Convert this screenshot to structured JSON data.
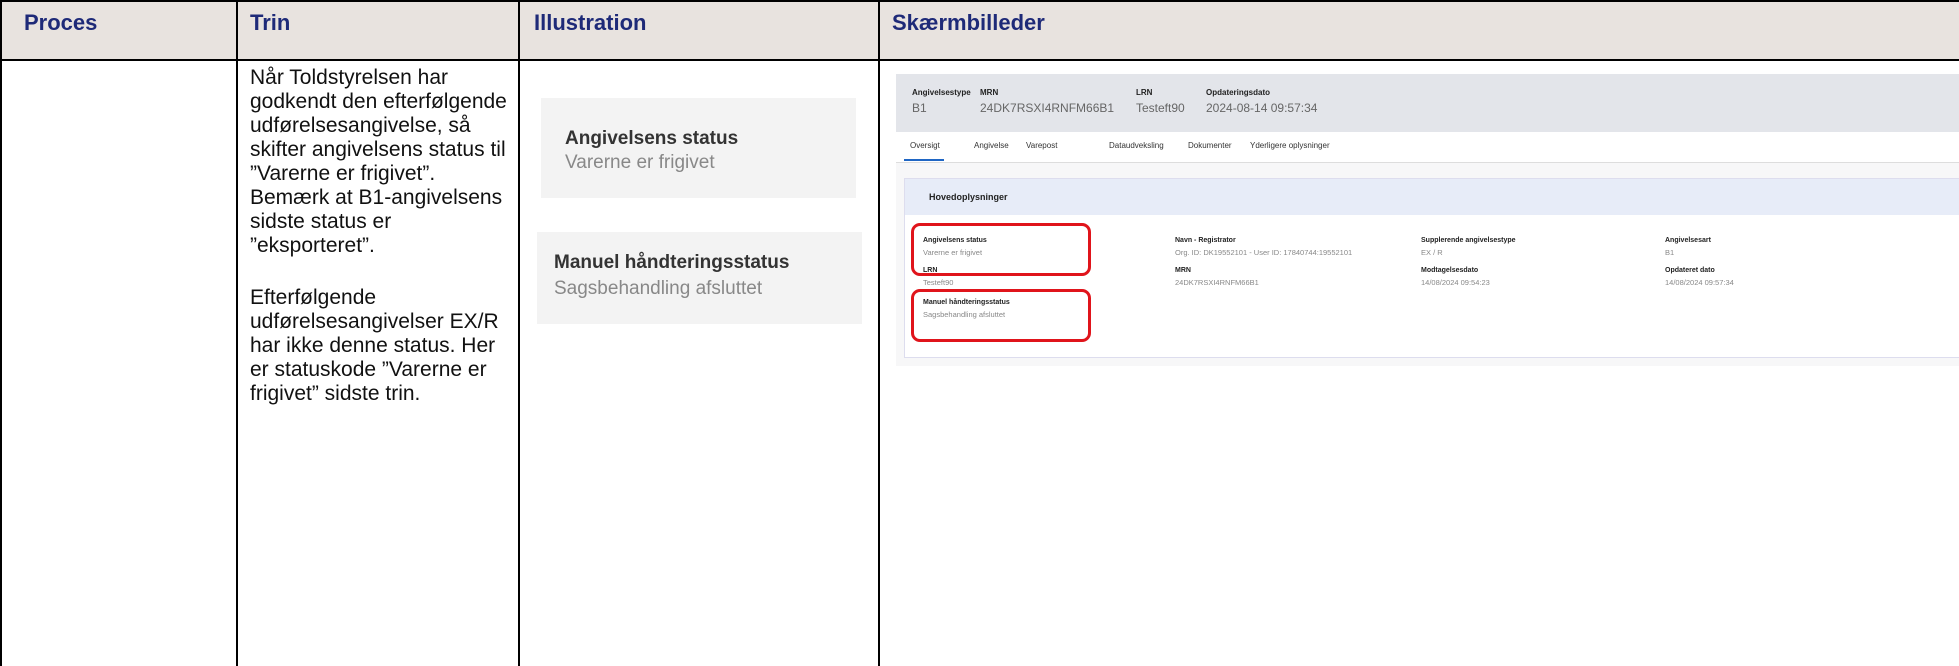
{
  "table": {
    "headers": [
      "Proces",
      "Trin",
      "Illustration",
      "Skærmbilleder"
    ],
    "trin_paragraph_1": "Når Toldstyrelsen har godkendt den efterfølgende udførelsesangivelse, så skifter angivelsens status til ”Varerne er frigivet”. Bemærk at B1-angivelsens sidste status er ”eksporteret”.",
    "trin_paragraph_2": "Efterfølgende udførelsesangivelser EX/R har ikke denne status. Her er statuskode ”Varerne er frigivet” sidste trin."
  },
  "illustration": {
    "card1": {
      "title": "Angivelsens status",
      "value": "Varerne er frigivet"
    },
    "card2": {
      "title": "Manuel håndteringsstatus",
      "value": "Sagsbehandling afsluttet"
    }
  },
  "screenshot": {
    "header": [
      {
        "label": "Angivelsestype",
        "value": "B1"
      },
      {
        "label": "MRN",
        "value": "24DK7RSXI4RNFM66B1"
      },
      {
        "label": "LRN",
        "value": "Testeft90"
      },
      {
        "label": "Opdateringsdato",
        "value": "2024-08-14 09:57:34"
      }
    ],
    "tabs": [
      "Oversigt",
      "Angivelse",
      "Varepost",
      "Dataudveksling",
      "Dokumenter",
      "Yderligere oplysninger"
    ],
    "panel_title": "Hovedoplysninger",
    "fields": [
      {
        "label": "Angivelsens status",
        "value": "Varerne er frigivet"
      },
      {
        "label": "Navn - Registrator",
        "value": "Org. ID: DK19552101 - User ID: 17840744:19552101"
      },
      {
        "label": "Supplerende angivelsestype",
        "value": "EX / R"
      },
      {
        "label": "Angivelsesart",
        "value": "B1"
      },
      {
        "label": "LRN",
        "value": "Testeft90"
      },
      {
        "label": "MRN",
        "value": "24DK7RSXI4RNFM66B1"
      },
      {
        "label": "Modtagelsesdato",
        "value": "14/08/2024 09:54:23"
      },
      {
        "label": "Opdateret dato",
        "value": "14/08/2024 09:57:34"
      },
      {
        "label": "Manuel håndteringsstatus",
        "value": "Sagsbehandling afsluttet"
      }
    ],
    "highlight_color": "#e0141b"
  }
}
